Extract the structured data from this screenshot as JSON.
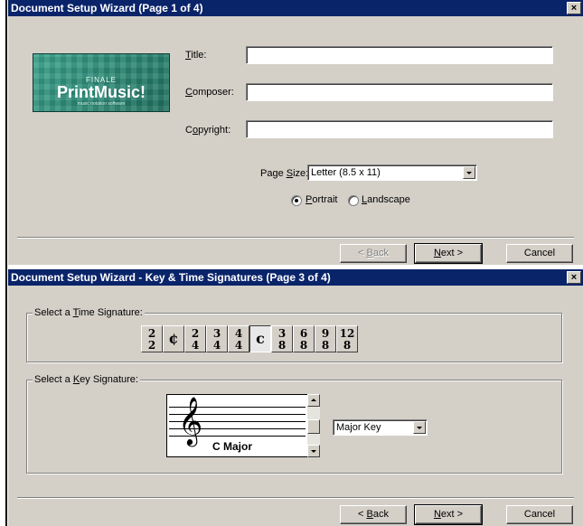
{
  "window1": {
    "title": "Document Setup Wizard (Page 1 of 4)",
    "close": "×",
    "logo": {
      "finale": "FINALE",
      "name": "PrintMusic!",
      "tagline": "music notation software"
    },
    "fields": {
      "title_label_u": "T",
      "title_label_rest": "itle:",
      "title_value": "",
      "composer_label_u": "C",
      "composer_label_rest": "omposer:",
      "composer_value": "",
      "copyright_label_pre": "C",
      "copyright_label_u": "o",
      "copyright_label_rest": "pyright:",
      "copyright_value": ""
    },
    "page_size": {
      "label_pre": "Page ",
      "label_u": "S",
      "label_rest": "ize:",
      "value": "Letter (8.5 x 11)"
    },
    "orientation": {
      "portrait_u": "P",
      "portrait_rest": "ortrait",
      "portrait_checked": true,
      "landscape_u": "L",
      "landscape_rest": "andscape",
      "landscape_checked": false
    },
    "buttons": {
      "back_pre": "< ",
      "back_u": "B",
      "back_rest": "ack",
      "back_enabled": false,
      "next_u": "N",
      "next_rest": "ext >",
      "cancel": "Cancel"
    }
  },
  "window2": {
    "title": "Document Setup Wizard - Key & Time Signatures (Page 3 of 4)",
    "close": "×",
    "time_group": {
      "label_pre": "Select a ",
      "label_u": "T",
      "label_rest": "ime Signature:"
    },
    "time_signatures": [
      {
        "top": "2",
        "bottom": "2",
        "symbol": ""
      },
      {
        "top": "",
        "bottom": "",
        "symbol": "¢"
      },
      {
        "top": "2",
        "bottom": "4",
        "symbol": ""
      },
      {
        "top": "3",
        "bottom": "4",
        "symbol": ""
      },
      {
        "top": "4",
        "bottom": "4",
        "symbol": ""
      },
      {
        "top": "",
        "bottom": "",
        "symbol": "c",
        "selected": true
      },
      {
        "top": "3",
        "bottom": "8",
        "symbol": ""
      },
      {
        "top": "6",
        "bottom": "8",
        "symbol": ""
      },
      {
        "top": "9",
        "bottom": "8",
        "symbol": ""
      },
      {
        "top": "12",
        "bottom": "8",
        "symbol": ""
      }
    ],
    "key_group": {
      "label_pre": "Select a ",
      "label_u": "K",
      "label_rest": "ey Signature:"
    },
    "key": {
      "clef": "𝄞",
      "name": "C Major",
      "mode": "Major Key"
    },
    "buttons": {
      "back_pre": "< ",
      "back_u": "B",
      "back_rest": "ack",
      "next_u": "N",
      "next_rest": "ext >",
      "cancel": "Cancel"
    }
  }
}
